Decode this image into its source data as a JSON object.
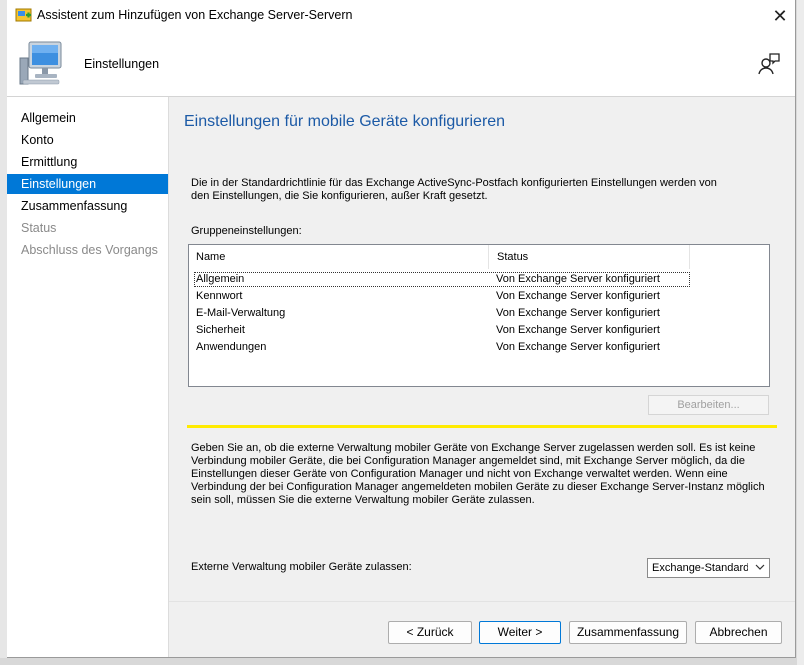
{
  "window": {
    "title": "Assistent zum Hinzufügen von Exchange Server-Servern",
    "close_glyph": "✕"
  },
  "header": {
    "title": "Einstellungen"
  },
  "nav": {
    "items": [
      {
        "label": "Allgemein",
        "state": "normal"
      },
      {
        "label": "Konto",
        "state": "normal"
      },
      {
        "label": "Ermittlung",
        "state": "normal"
      },
      {
        "label": "Einstellungen",
        "state": "selected"
      },
      {
        "label": "Zusammenfassung",
        "state": "normal"
      },
      {
        "label": "Status",
        "state": "disabled"
      },
      {
        "label": "Abschluss des Vorgangs",
        "state": "disabled"
      }
    ]
  },
  "main": {
    "title": "Einstellungen für mobile Geräte konfigurieren",
    "description": "Die in der Standardrichtlinie für das Exchange ActiveSync-Postfach konfigurierten Einstellungen werden von den Einstellungen, die Sie konfigurieren, außer Kraft gesetzt.",
    "group_label": "Gruppeneinstellungen:",
    "table": {
      "headers": [
        "Name",
        "Status"
      ],
      "rows": [
        {
          "name": "Allgemein",
          "status": "Von Exchange Server konfiguriert"
        },
        {
          "name": "Kennwort",
          "status": "Von Exchange Server konfiguriert"
        },
        {
          "name": "E-Mail-Verwaltung",
          "status": "Von Exchange Server konfiguriert"
        },
        {
          "name": "Sicherheit",
          "status": "Von Exchange Server konfiguriert"
        },
        {
          "name": "Anwendungen",
          "status": "Von Exchange Server konfiguriert"
        }
      ]
    },
    "edit_button": "Bearbeiten...",
    "info_text": "Geben Sie an, ob die externe Verwaltung mobiler Geräte von Exchange Server zugelassen werden soll. Es ist keine Verbindung mobiler Geräte, die bei Configuration Manager angemeldet sind, mit Exchange Server möglich, da die Einstellungen dieser Geräte von Configuration Manager und nicht von Exchange verwaltet werden. Wenn eine Verbindung der bei Configuration Manager angemeldeten mobilen Geräte zu dieser Exchange Server-Instanz möglich sein soll, müssen Sie die externe Verwaltung mobiler Geräte zulassen.",
    "external_label": "Externe Verwaltung mobiler Geräte zulassen:",
    "external_value": "Exchange-Standardw"
  },
  "buttons": {
    "back": "< Zurück",
    "next": "Weiter >",
    "summary": "Zusammenfassung",
    "cancel": "Abbrechen"
  },
  "colors": {
    "accent": "#0078d7",
    "title_blue": "#1c5aa6",
    "separator_yellow": "#ffeb00",
    "panel_bg": "#f0f0f0"
  },
  "icons": {
    "app": "wizard-app-icon",
    "header": "computer-icon",
    "help": "help-person-icon",
    "close": "close-icon",
    "dropdown": "chevron-down-icon"
  }
}
